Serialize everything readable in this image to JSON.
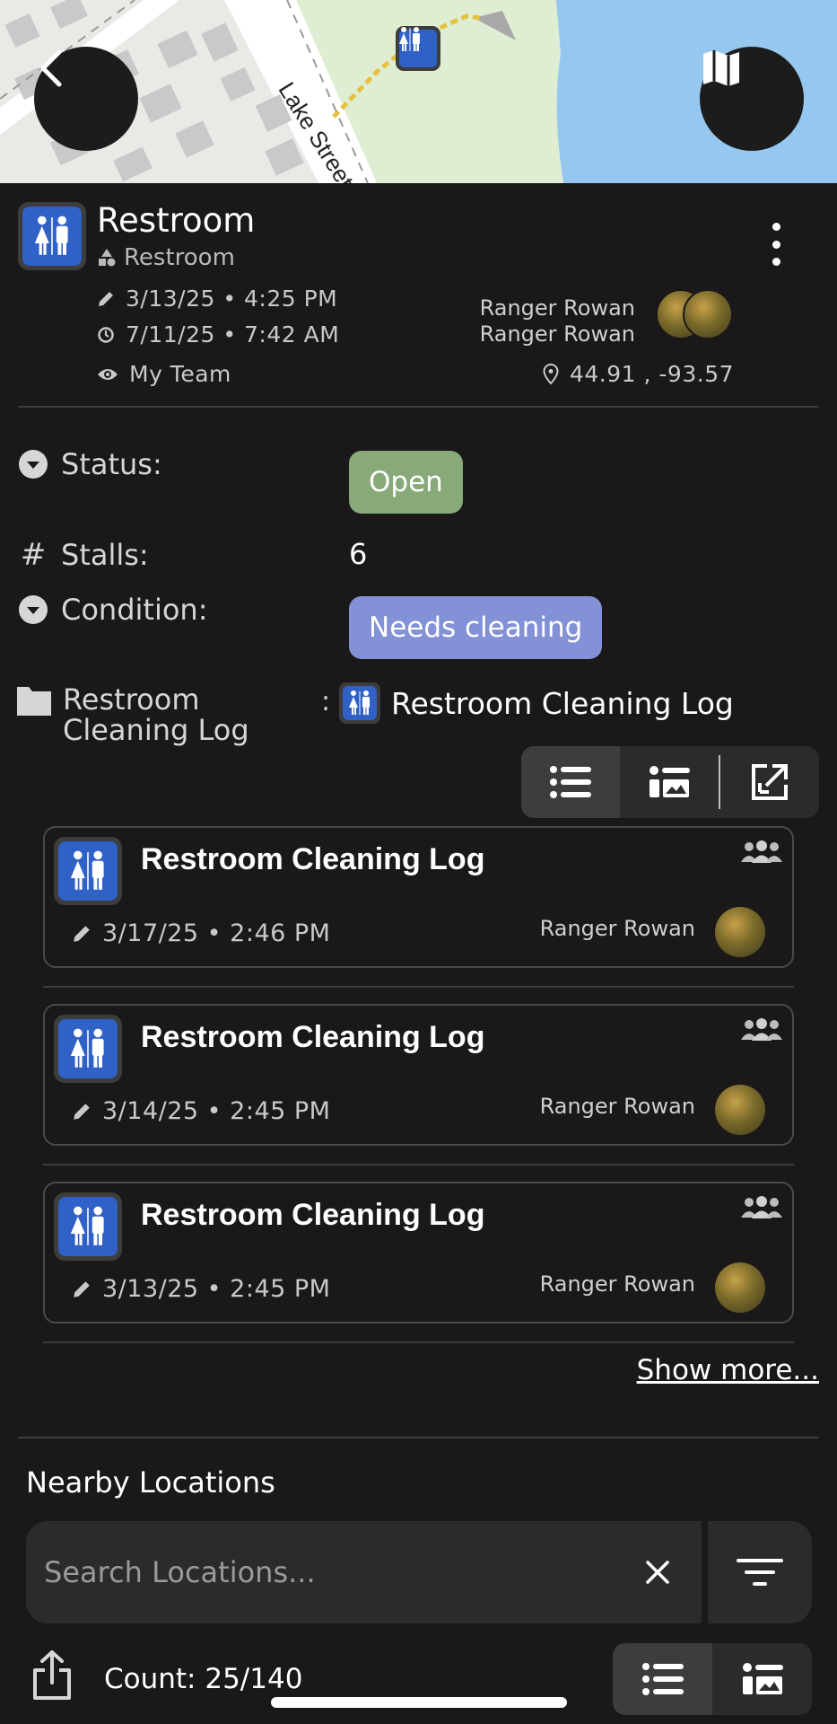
{
  "map": {
    "street_label": "Lake Street"
  },
  "header": {
    "title": "Restroom",
    "category": "Restroom",
    "edited_time": "3/13/25 • 4:25 PM",
    "created_time": "7/11/25 • 7:42 AM",
    "visibility": "My Team",
    "edited_by": "Ranger Rowan",
    "created_by": "Ranger Rowan",
    "coordinates": "44.91 , -93.57"
  },
  "fields": {
    "status_label": "Status:",
    "status_value": "Open",
    "stalls_label": "Stalls:",
    "stalls_value": "6",
    "condition_label": "Condition:",
    "condition_value": "Needs cleaning",
    "log_label": "Restroom Cleaning Log",
    "log_colon": ":",
    "log_link": "Restroom Cleaning Log"
  },
  "log_entries": [
    {
      "title": "Restroom Cleaning Log",
      "date": "3/17/25 • 2:46 PM",
      "by": "Ranger Rowan"
    },
    {
      "title": "Restroom Cleaning Log",
      "date": "3/14/25 • 2:45 PM",
      "by": "Ranger Rowan"
    },
    {
      "title": "Restroom Cleaning Log",
      "date": "3/13/25 • 2:45 PM",
      "by": "Ranger Rowan"
    }
  ],
  "show_more": "Show more...",
  "nearby": {
    "heading": "Nearby Locations",
    "search_placeholder": "Search Locations...",
    "count": "Count: 25/140"
  },
  "colors": {
    "background": "#1a1819",
    "open_chip": "#88aa78",
    "condition_chip": "#8391d6",
    "restroom_icon": "#2f61c6"
  }
}
